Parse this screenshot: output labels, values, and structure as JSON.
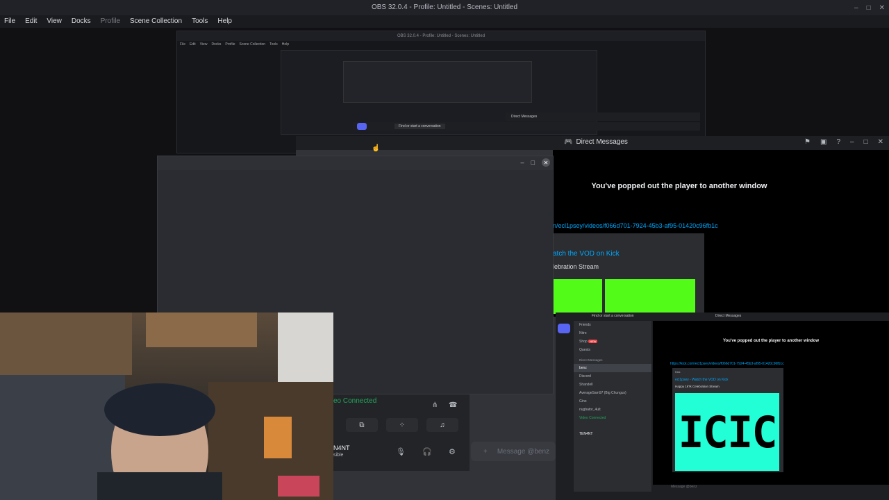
{
  "obs": {
    "title": "OBS 32.0.4 - Profile: Untitled - Scenes: Untitled",
    "controls": [
      "–",
      "□",
      "✕"
    ],
    "menu": [
      "File",
      "Edit",
      "View",
      "Docks",
      "Profile",
      "Scene Collection",
      "Tools",
      "Help"
    ]
  },
  "nested": {
    "title": "OBS 32.0.4 - Profile: Untitled - Scenes: Untitled",
    "menu": [
      "File",
      "Edit",
      "View",
      "Docks",
      "Profile",
      "Scene Collection",
      "Tools",
      "Help"
    ],
    "find_conversation": "Find or start a conversation",
    "direct_messages": "Direct Messages"
  },
  "discord": {
    "window_title": "Direct Messages",
    "popped_out": "You've popped out the player to another window",
    "link": "n/ecl1psey/videos/f066d701-7924-45b3-af95-01420c96fb1c",
    "vod_title": "atch the VOD on Kick",
    "vod_subtitle": "lebration Stream",
    "voice_status": "eo Connected",
    "username": "N4NT",
    "user_status": "sible",
    "message_placeholder": "Message @benz"
  },
  "mini": {
    "find_conversation": "Find or start a conversation",
    "window_title": "Direct Messages",
    "channels": [
      "Friends",
      "Nitro",
      "Shop",
      "Quests"
    ],
    "shop_badge": "NEW",
    "dm_header": "Direct Messages",
    "dms": [
      "benz",
      "Discord",
      "Shandell",
      "AverageSam97 (Big Chungus)",
      "Gino",
      "nugbator_4ult"
    ],
    "popped_out": "You've popped out the player to another window",
    "link": "https://kick.com/ecl1psey/videos/f066d701-7924-45b3-af95-01420c96fb1c",
    "embed_source": "Kick",
    "vod_title": "ecl1psey - Watch the VOD on Kick",
    "vod_subtitle": "Happy 1k?k Celebration Stream",
    "voice_status": "Video Connected",
    "username": "TEN4NT",
    "message_placeholder": "Message @benz"
  },
  "colors": {
    "kick_green": "#53fc18",
    "discord_link": "#00a8fc",
    "voice_green": "#23a55a"
  }
}
